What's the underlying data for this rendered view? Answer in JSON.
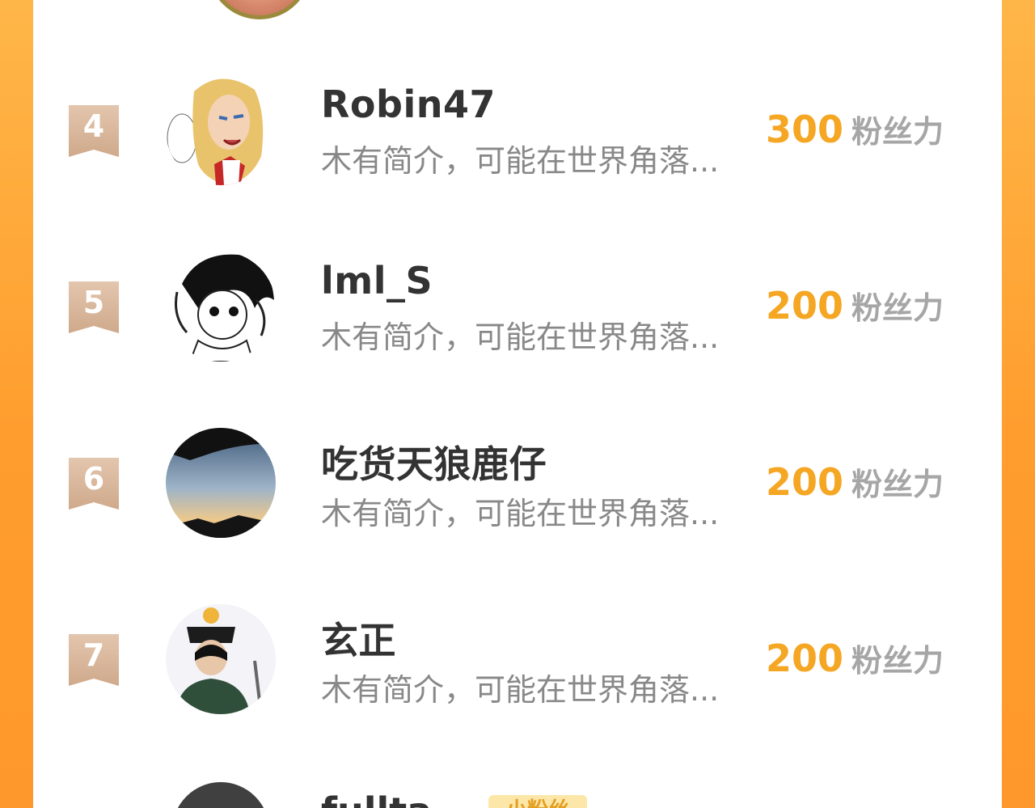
{
  "fans_unit": "粉丝力",
  "entries": [
    {
      "rank": "4",
      "name": "Robin47",
      "intro": "木有简介，可能在世界角落...",
      "fans": "300",
      "avatar_icon": "anime-blond-character-avatar"
    },
    {
      "rank": "5",
      "name": "lml_S",
      "intro": "木有简介，可能在世界角落...",
      "fans": "200",
      "avatar_icon": "manga-black-haired-character-avatar"
    },
    {
      "rank": "6",
      "name": "吃货天狼鹿仔",
      "intro": "木有简介，可能在世界角落...",
      "fans": "200",
      "avatar_icon": "sky-rooftop-photo-avatar"
    },
    {
      "rank": "7",
      "name": "玄正",
      "intro": "木有简介，可能在世界角落...",
      "fans": "200",
      "avatar_icon": "hat-warrior-character-avatar"
    }
  ],
  "partial_entry": {
    "name": "fullta...",
    "badge": "小粉丝",
    "avatar_icon": "dark-avatar"
  },
  "colors": {
    "background_gradient": [
      "#ffb648",
      "#ff9d2e"
    ],
    "fans_value": "#f5a623",
    "fans_unit": "#a6a6a6",
    "rank_ribbon": "#d4b094",
    "name": "#333333",
    "intro": "#888888"
  }
}
